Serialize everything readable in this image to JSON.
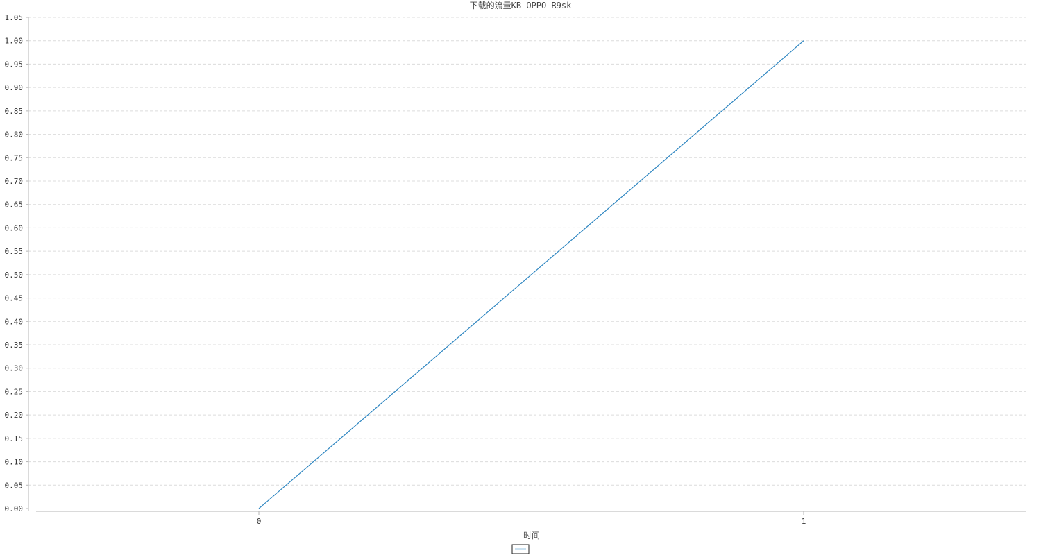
{
  "chart_data": {
    "type": "line",
    "title": "下载的流量KB_OPPO R9sk",
    "xlabel": "时间",
    "ylabel": "",
    "categories": [
      "0",
      "1"
    ],
    "series": [
      {
        "values": [
          0,
          1
        ],
        "color": "#2e86c1"
      }
    ],
    "ylim": [
      0,
      1.05
    ],
    "yticks": [
      "0.00",
      "0.05",
      "0.10",
      "0.15",
      "0.20",
      "0.25",
      "0.30",
      "0.35",
      "0.40",
      "0.45",
      "0.50",
      "0.55",
      "0.60",
      "0.65",
      "0.70",
      "0.75",
      "0.80",
      "0.85",
      "0.90",
      "0.95",
      "1.00",
      "1.05"
    ],
    "grid": true,
    "legend_position": "bottom-center"
  }
}
